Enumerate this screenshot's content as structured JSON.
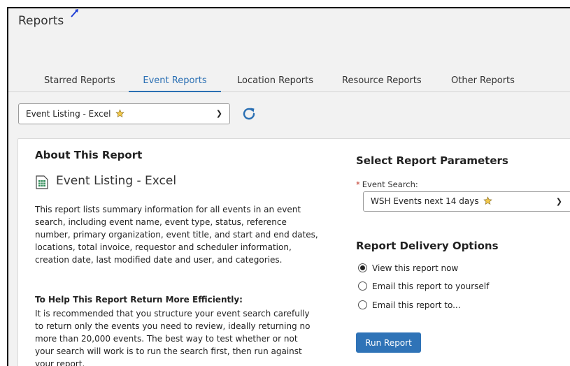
{
  "page": {
    "title": "Reports"
  },
  "tabs": [
    {
      "label": "Starred Reports",
      "active": false
    },
    {
      "label": "Event Reports",
      "active": true
    },
    {
      "label": "Location Reports",
      "active": false
    },
    {
      "label": "Resource Reports",
      "active": false
    },
    {
      "label": "Other Reports",
      "active": false
    }
  ],
  "report_select": {
    "value": "Event Listing - Excel",
    "starred": true
  },
  "about": {
    "heading": "About This Report",
    "report_name": "Event Listing - Excel",
    "description": "This report lists summary information for all events in an event search, including event name, event type, status, reference number, primary organization, event title, and start and end dates, locations, total invoice, requestor and scheduler information, creation date, last modified date and user, and categories.",
    "tip_heading": "To Help This Report Return More Efficiently:",
    "tip_body": "It is recommended that you structure your event search carefully to return only the events you need to review, ideally returning no more than 20,000 events. The best way to test whether or not your search will work is to run the search first, then run against your report."
  },
  "parameters": {
    "heading": "Select Report Parameters",
    "event_search_label": "Event Search:",
    "required_marker": "*",
    "event_search_value": "WSH Events next 14 days",
    "event_search_starred": true
  },
  "delivery": {
    "heading": "Report Delivery Options",
    "options": [
      {
        "label": "View this report now",
        "checked": true
      },
      {
        "label": "Email this report to yourself",
        "checked": false
      },
      {
        "label": "Email this report to...",
        "checked": false
      }
    ]
  },
  "actions": {
    "run_label": "Run Report"
  },
  "colors": {
    "accent": "#2a6fb3",
    "button": "#2f73b7",
    "required": "#c0392b",
    "star": "#f2c94c"
  }
}
